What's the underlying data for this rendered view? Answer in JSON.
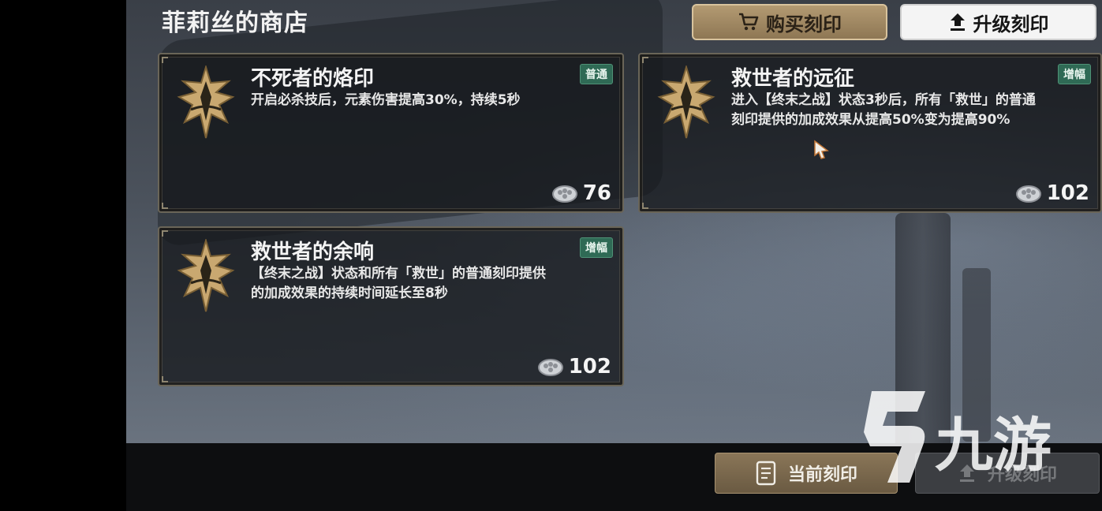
{
  "shop": {
    "title": "菲莉丝的商店"
  },
  "top_buttons": {
    "buy_label": "购买刻印",
    "upgrade_label": "升级刻印"
  },
  "cards": [
    {
      "name": "不死者的烙印",
      "tag": "普通",
      "desc_line1": "开启必杀技后，元素伤害提高30%，持续5秒",
      "desc_line2": "",
      "price": "76"
    },
    {
      "name": "救世者的远征",
      "tag": "增幅",
      "desc_line1": "进入【终末之战】状态3秒后，所有「救世」的普通",
      "desc_line2": "刻印提供的加成效果从提高50%变为提高90%",
      "price": "102"
    },
    {
      "name": "救世者的余响",
      "tag": "增幅",
      "desc_line1": "【终末之战】状态和所有「救世」的普通刻印提供",
      "desc_line2": "的加成效果的持续时间延长至8秒",
      "price": "102"
    }
  ],
  "bottom_buttons": {
    "current_label": "当前刻印",
    "upgrade_label": "升级刻印"
  },
  "watermark": {
    "text": "九游"
  },
  "colors": {
    "tag_green": "#2f6a55",
    "gold": "#b39a72",
    "card_bg": "#16181c"
  },
  "icons": [
    "cart-icon",
    "upload-icon",
    "emblem-icon",
    "currency-icon",
    "document-icon",
    "cursor-icon"
  ]
}
